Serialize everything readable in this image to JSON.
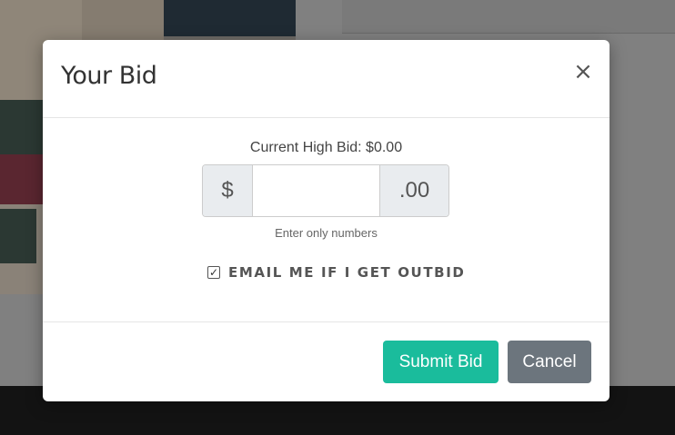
{
  "modal": {
    "title": "Your Bid",
    "close_symbol": "×",
    "current_high_bid": "Current High Bid: $0.00",
    "currency_prefix": "$",
    "currency_suffix": ".00",
    "bid_value": "",
    "help_text": "Enter only numbers",
    "email_outbid": {
      "checked": true,
      "label": "EMAIL ME IF I GET OUTBID"
    },
    "buttons": {
      "submit": "Submit Bid",
      "cancel": "Cancel"
    }
  },
  "colors": {
    "submit": "#1abc9c",
    "cancel": "#6c757d",
    "overlay": "#7c7c7c",
    "footer_bg": "#131313"
  },
  "icons": {
    "close": "close-icon",
    "checkbox": "checkbox-checked-icon"
  }
}
